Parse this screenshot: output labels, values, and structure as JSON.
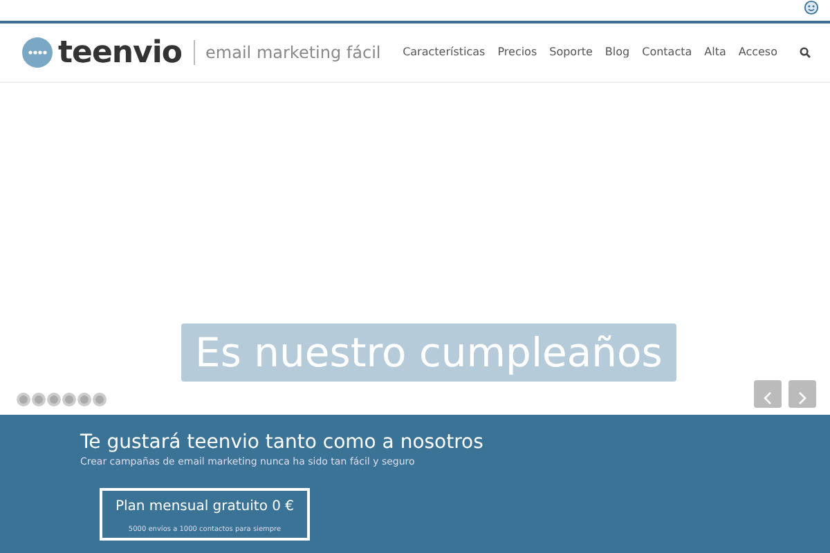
{
  "logo": {
    "name": "teenvio",
    "tagline": "email marketing fácil"
  },
  "nav": {
    "items": [
      "Características",
      "Precios",
      "Soporte",
      "Blog",
      "Contacta",
      "Alta",
      "Acceso"
    ]
  },
  "slider": {
    "caption": "Es nuestro cumpleaños",
    "dots": [
      {
        "selected": false
      },
      {
        "selected": false
      },
      {
        "selected": false
      },
      {
        "selected": false
      },
      {
        "selected": false
      },
      {
        "selected": false
      }
    ]
  },
  "promo": {
    "title": "Te gustará teenvio tanto como a nosotros",
    "subtitle": "Crear campañas de email marketing nunca ha sido tan fácil y seguro",
    "cta": {
      "label": "Plan mensual gratuito 0 €",
      "note": "5000 envíos a 1000 contactos para siempre"
    }
  }
}
